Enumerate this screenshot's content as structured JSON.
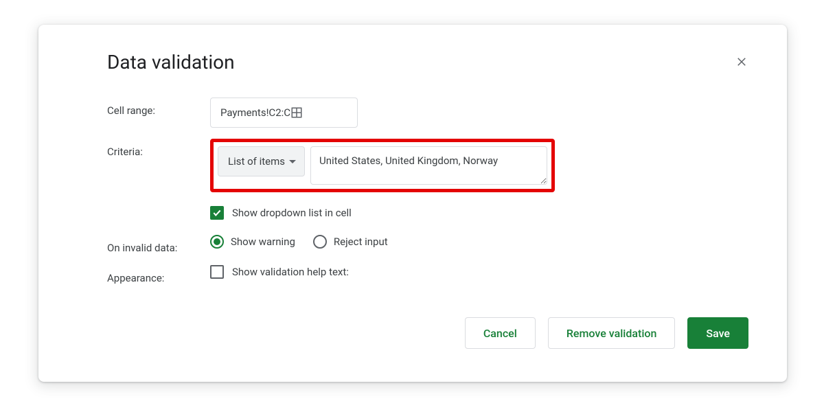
{
  "dialog": {
    "title": "Data validation",
    "cell_range_label": "Cell range:",
    "cell_range_value": "Payments!C2:C",
    "criteria_label": "Criteria:",
    "criteria_dropdown": "List of items",
    "criteria_items": "United States, United Kingdom, Norway",
    "show_dropdown_label": "Show dropdown list in cell",
    "show_dropdown_checked": true,
    "on_invalid_label": "On invalid data:",
    "radio_show_warning": "Show warning",
    "radio_reject_input": "Reject input",
    "invalid_selected": "show_warning",
    "appearance_label": "Appearance:",
    "appearance_checkbox_label": "Show validation help text:",
    "appearance_checked": false,
    "buttons": {
      "cancel": "Cancel",
      "remove": "Remove validation",
      "save": "Save"
    }
  }
}
